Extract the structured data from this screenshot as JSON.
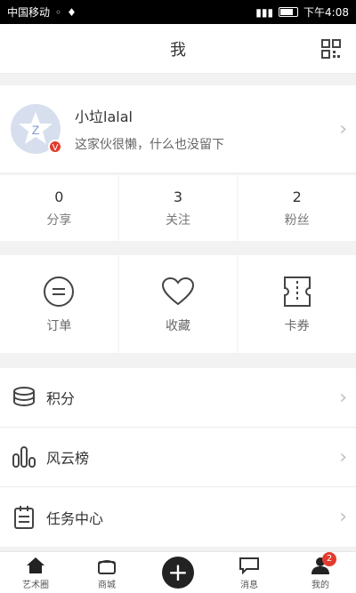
{
  "status_bar": {
    "carrier": "中国移动",
    "time": "下午4:08"
  },
  "header": {
    "title": "我"
  },
  "profile": {
    "name": "小垃lalal",
    "bio": "这家伙很懒，什么也没留下",
    "badge": "V"
  },
  "stats": [
    {
      "count": "0",
      "label": "分享"
    },
    {
      "count": "3",
      "label": "关注"
    },
    {
      "count": "2",
      "label": "粉丝"
    }
  ],
  "quick_actions": [
    {
      "label": "订单",
      "icon": "order-icon"
    },
    {
      "label": "收藏",
      "icon": "heart-icon"
    },
    {
      "label": "卡券",
      "icon": "ticket-icon"
    }
  ],
  "menu": [
    {
      "label": "积分",
      "icon": "coins-icon"
    },
    {
      "label": "风云榜",
      "icon": "ranking-icon"
    },
    {
      "label": "任务中心",
      "icon": "task-icon"
    }
  ],
  "bottom_nav": [
    {
      "label": "艺术圈",
      "icon": "home-icon"
    },
    {
      "label": "商城",
      "icon": "shop-icon"
    },
    {
      "label": "",
      "icon": "add-icon"
    },
    {
      "label": "消息",
      "icon": "message-icon"
    },
    {
      "label": "我的",
      "icon": "user-icon",
      "badge": "2"
    }
  ],
  "colors": {
    "accent_red": "#e23b2e",
    "background": "#f2f2f2"
  }
}
